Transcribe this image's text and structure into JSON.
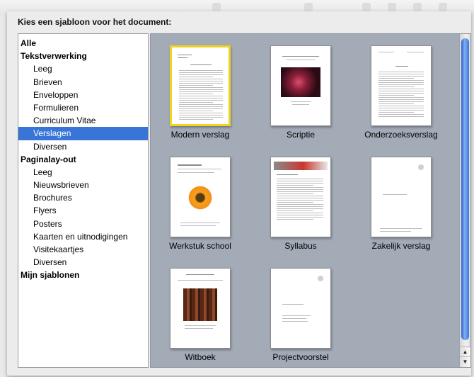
{
  "dialog": {
    "prompt": "Kies een sjabloon voor het document:"
  },
  "categories": [
    {
      "label": "Alle",
      "level": "group"
    },
    {
      "label": "Tekstverwerking",
      "level": "group"
    },
    {
      "label": "Leeg",
      "level": "sub"
    },
    {
      "label": "Brieven",
      "level": "sub"
    },
    {
      "label": "Enveloppen",
      "level": "sub"
    },
    {
      "label": "Formulieren",
      "level": "sub"
    },
    {
      "label": "Curriculum Vitae",
      "level": "sub"
    },
    {
      "label": "Verslagen",
      "level": "sub",
      "selected": true
    },
    {
      "label": "Diversen",
      "level": "sub"
    },
    {
      "label": "Paginalay-out",
      "level": "group"
    },
    {
      "label": "Leeg",
      "level": "sub"
    },
    {
      "label": "Nieuwsbrieven",
      "level": "sub"
    },
    {
      "label": "Brochures",
      "level": "sub"
    },
    {
      "label": "Flyers",
      "level": "sub"
    },
    {
      "label": "Posters",
      "level": "sub"
    },
    {
      "label": "Kaarten en uitnodigingen",
      "level": "sub"
    },
    {
      "label": "Visitekaartjes",
      "level": "sub"
    },
    {
      "label": "Diversen",
      "level": "sub"
    },
    {
      "label": "Mijn sjablonen",
      "level": "group"
    }
  ],
  "templates": [
    {
      "name": "Modern verslag",
      "selected": true
    },
    {
      "name": "Scriptie"
    },
    {
      "name": "Onderzoeksverslag"
    },
    {
      "name": "Werkstuk school"
    },
    {
      "name": "Syllabus"
    },
    {
      "name": "Zakelijk verslag"
    },
    {
      "name": "Witboek"
    },
    {
      "name": "Projectvoorstel"
    }
  ],
  "colors": {
    "selection": "#3875d7",
    "gallery_bg": "#a3abb7",
    "thumb_highlight": "#f1d321"
  },
  "icons": {
    "scroll_up": "▲",
    "scroll_down": "▼"
  }
}
